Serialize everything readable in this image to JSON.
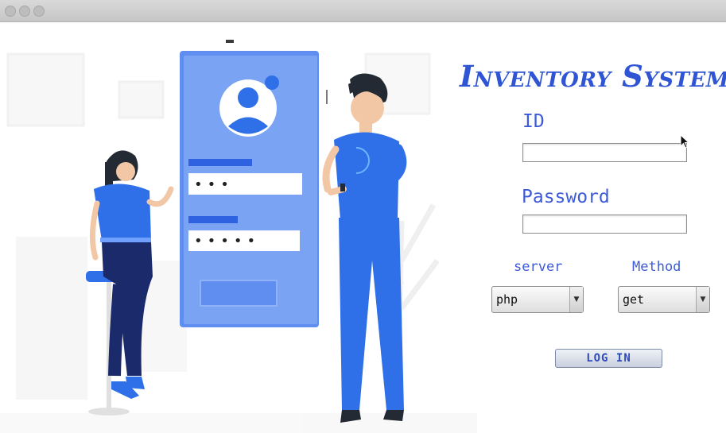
{
  "window": {
    "title_bar_buttons": [
      "close",
      "minimize",
      "maximize"
    ]
  },
  "app": {
    "title": "Inventory System"
  },
  "form": {
    "id_label": "ID",
    "id_value": "",
    "password_label": "Password",
    "password_value": "",
    "server_label": "server",
    "server_value": "php",
    "method_label": "Method",
    "method_value": "get",
    "login_label": "LOG IN"
  },
  "illustration": {
    "password_dots_short": "•••",
    "password_dots_long": "•••••"
  },
  "colors": {
    "accent": "#2f55d4",
    "label": "#3d5bd9",
    "figure_blue": "#2b6fe8",
    "phone_panel": "#6b96ee"
  }
}
